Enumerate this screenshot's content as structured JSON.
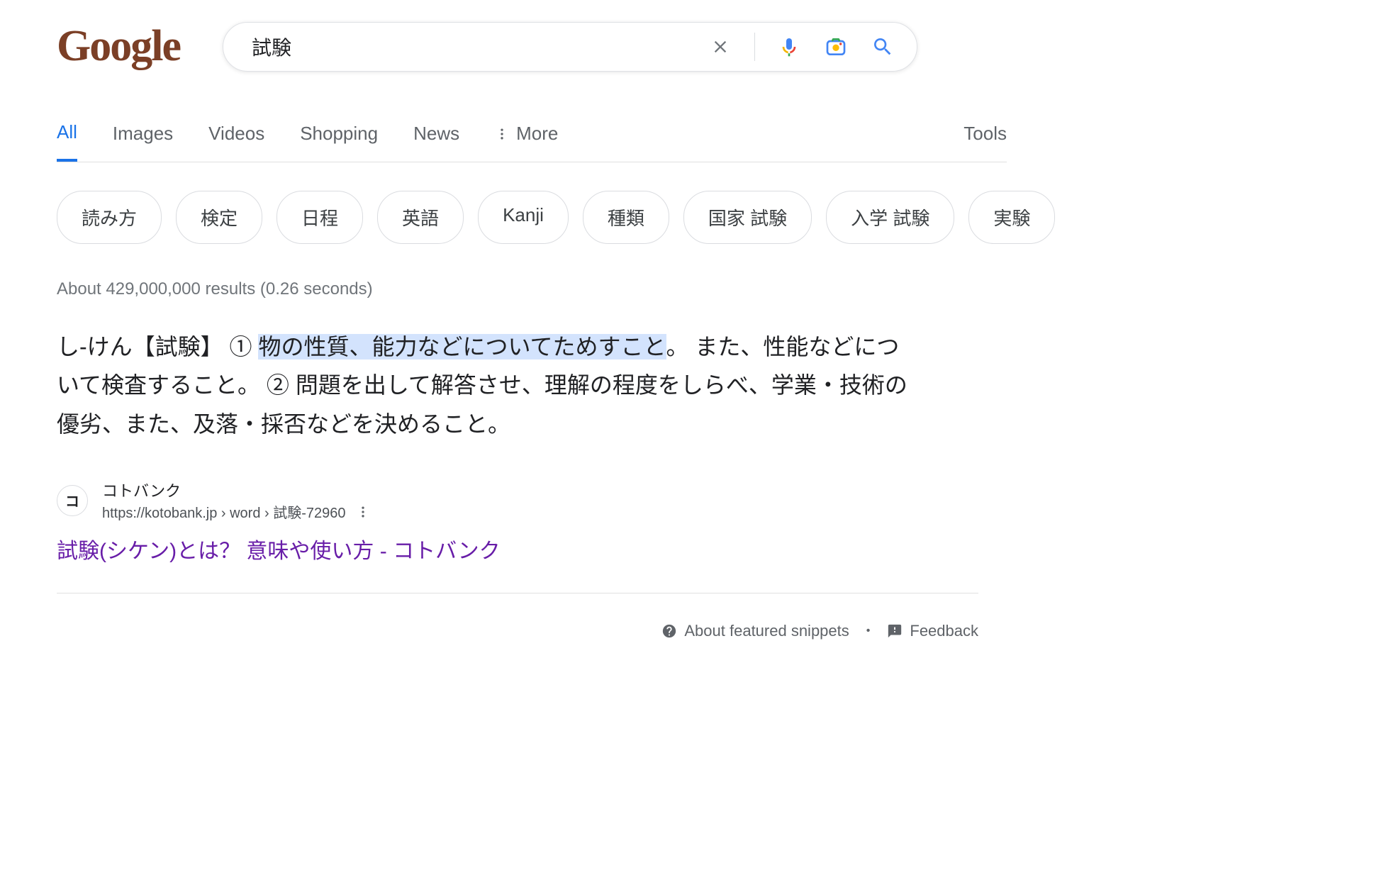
{
  "search": {
    "query": "試験",
    "logo_text": "Google"
  },
  "tabs": {
    "all": "All",
    "images": "Images",
    "videos": "Videos",
    "shopping": "Shopping",
    "news": "News",
    "more": "More",
    "tools": "Tools"
  },
  "chips": [
    "読み方",
    "検定",
    "日程",
    "英語",
    "Kanji",
    "種類",
    "国家 試験",
    "入学 試験",
    "実験"
  ],
  "stats": "About 429,000,000 results (0.26 seconds)",
  "snippet": {
    "prefix": "し‐けん【試験】 ① ",
    "highlight": "物の性質、能力などについてためすこと",
    "suffix": "。 また、性能などについて検査すること。 ② 問題を出して解答させ、理解の程度をしらべ、学業・技術の優劣、また、及落・採否などを決めること。"
  },
  "result": {
    "site_name": "コトバンク",
    "breadcrumb": "https://kotobank.jp › word › 試験-72960",
    "title": "試験(シケン)とは？ 意味や使い方 - コトバンク",
    "favicon_letter": "コ"
  },
  "footer": {
    "about": "About featured snippets",
    "feedback": "Feedback"
  }
}
